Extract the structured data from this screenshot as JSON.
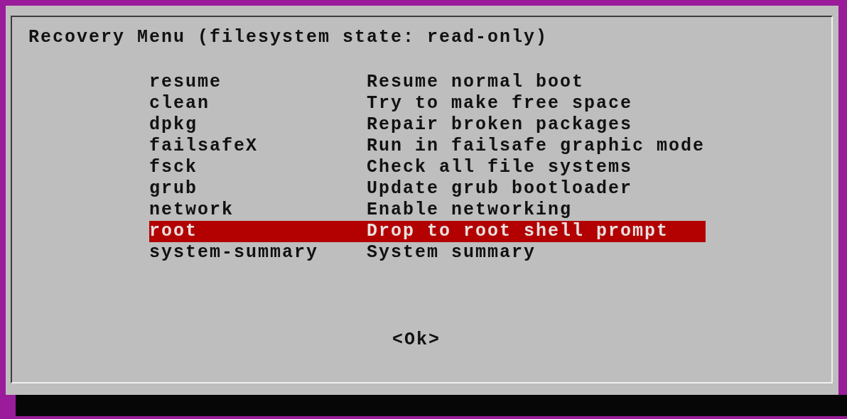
{
  "dialog": {
    "title": "Recovery Menu (filesystem state: read-only)",
    "items": [
      {
        "name": "resume",
        "description": "Resume normal boot",
        "selected": false
      },
      {
        "name": "clean",
        "description": "Try to make free space",
        "selected": false
      },
      {
        "name": "dpkg",
        "description": "Repair broken packages",
        "selected": false
      },
      {
        "name": "failsafeX",
        "description": "Run in failsafe graphic mode",
        "selected": false
      },
      {
        "name": "fsck",
        "description": "Check all file systems",
        "selected": false
      },
      {
        "name": "grub",
        "description": "Update grub bootloader",
        "selected": false
      },
      {
        "name": "network",
        "description": "Enable networking",
        "selected": false
      },
      {
        "name": "root",
        "description": "Drop to root shell prompt",
        "selected": true
      },
      {
        "name": "system-summary",
        "description": "System summary",
        "selected": false
      }
    ],
    "button": {
      "label": "<Ok>"
    }
  }
}
